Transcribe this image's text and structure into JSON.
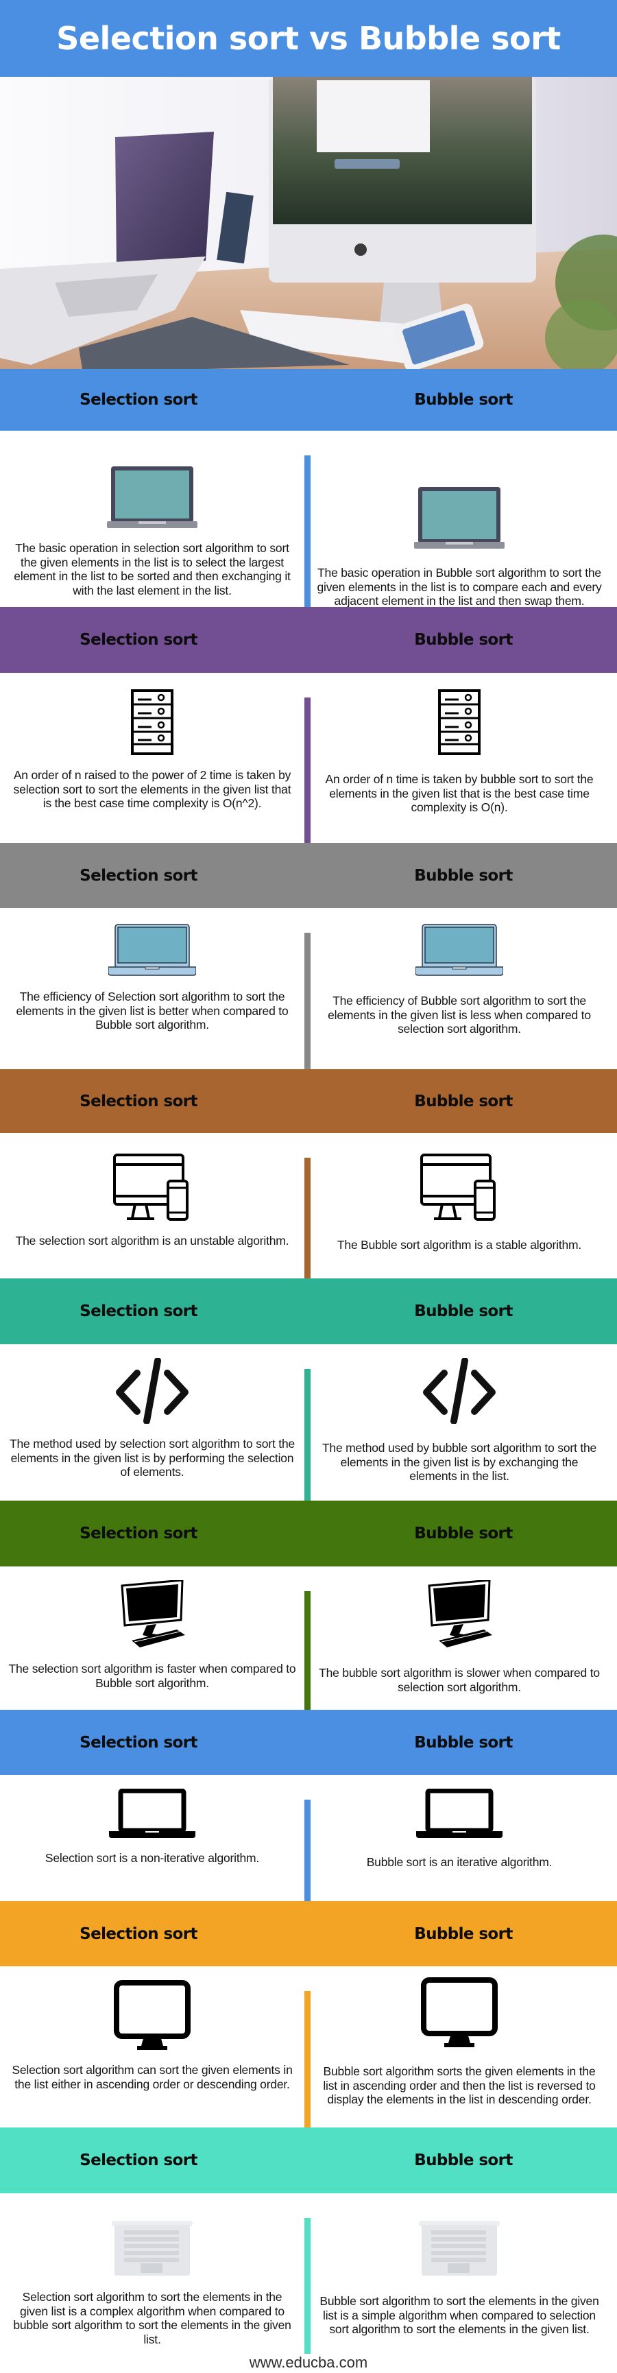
{
  "title": "Selection sort vs Bubble sort",
  "hero": {
    "image_alt": "Desk with laptop, iMac, keyboard, drawing tablet and smartphone"
  },
  "columns": {
    "left": "Selection sort",
    "right": "Bubble sort"
  },
  "sections": [
    {
      "color": "#4a8fe1",
      "icon": "laptop-icon",
      "left_heading": "Selection sort",
      "right_heading": "Bubble sort",
      "left": "The basic operation in selection sort algorithm to sort the given elements in the list is to select the largest element in the list to be sorted and then exchanging it with the last element in the list.",
      "right": "The basic operation in Bubble sort algorithm to sort the given elements in the list is to compare each and every adjacent element in the list and then swap them."
    },
    {
      "color": "#724e92",
      "icon": "server-rack-icon",
      "left_heading": "Selection sort",
      "right_heading": "Bubble sort",
      "left": "An order of n raised to the power of 2 time is taken by selection sort to sort the elements in the given list that is the best case time complexity is O(n^2).",
      "right": "An order of n time is taken by bubble sort to sort the elements in the given list that is the best case time complexity is O(n)."
    },
    {
      "color": "#878787",
      "icon": "laptop-light-icon",
      "left_heading": "Selection sort",
      "right_heading": "Bubble sort",
      "left": "The efficiency of Selection sort algorithm to sort the elements in the given list is better when compared to Bubble sort algorithm.",
      "right": "The efficiency of Bubble sort algorithm to sort the elements in the given list is less when compared to selection sort algorithm."
    },
    {
      "color": "#a9652f",
      "icon": "desktop-mobile-icon",
      "left_heading": "Selection sort",
      "right_heading": "Bubble sort",
      "left": "The selection sort algorithm is an unstable algorithm.",
      "right": "The Bubble sort algorithm is a stable algorithm."
    },
    {
      "color": "#2eb294",
      "icon": "code-icon",
      "left_heading": "Selection sort",
      "right_heading": "Bubble sort",
      "left": "The method used by selection sort algorithm to sort the elements in the given list is by performing the selection of elements.",
      "right": "The method used by bubble sort algorithm to sort the elements in the given list is by exchanging the elements in the list."
    },
    {
      "color": "#43760d",
      "icon": "desktop-computer-icon",
      "left_heading": "Selection sort",
      "right_heading": "Bubble sort",
      "left": "The selection sort algorithm is faster when compared to Bubble sort algorithm.",
      "right": "The bubble sort algorithm is slower when compared to selection sort algorithm."
    },
    {
      "color": "#4a8fe1",
      "icon": "laptop-outline-icon",
      "left_heading": "Selection sort",
      "right_heading": "Bubble sort",
      "left": "Selection sort is a non-iterative algorithm.",
      "right": "Bubble sort is an iterative algorithm."
    },
    {
      "color": "#f4a425",
      "icon": "monitor-icon",
      "left_heading": "Selection sort",
      "right_heading": "Bubble sort",
      "left": "Selection sort algorithm can sort the given elements in the list either in ascending order or descending order.",
      "right": "Bubble sort algorithm sorts the given elements in the list in ascending order and then the list is reversed to display the elements in the list in descending order."
    },
    {
      "color": "#52e0c4",
      "icon": "keyboard-laptop-icon",
      "left_heading": "Selection sort",
      "right_heading": "Bubble sort",
      "left": "Selection sort algorithm to sort the elements in the given list is a complex algorithm when compared to bubble sort algorithm to sort the elements in the given list.",
      "right": "Bubble sort algorithm to sort the elements in the given list is a simple algorithm when compared to selection sort algorithm to sort the elements in the given list."
    }
  ],
  "footer": "www.educba.com"
}
